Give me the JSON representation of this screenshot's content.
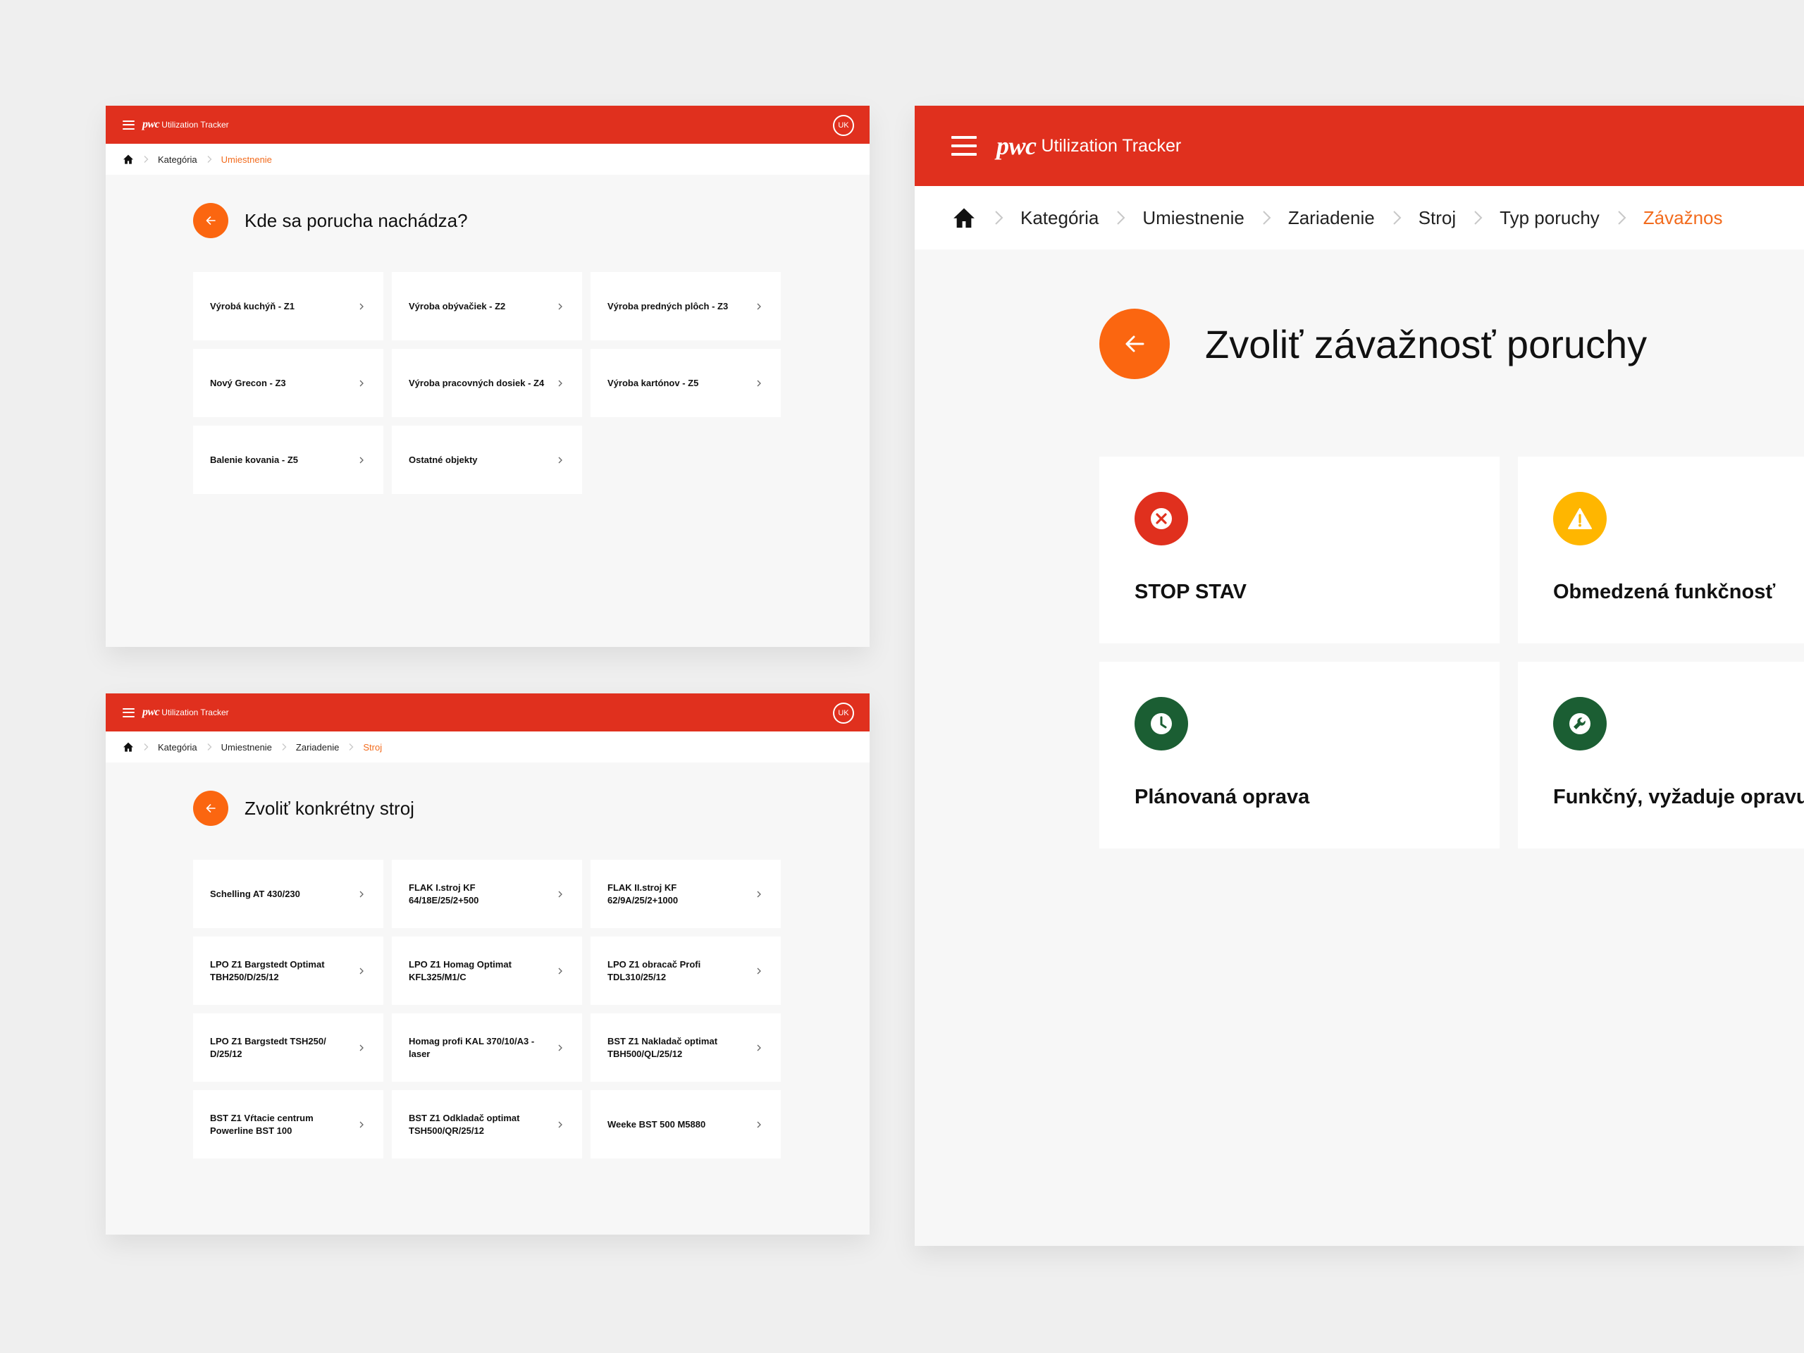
{
  "app": {
    "logo": "pwc",
    "name": "Utilization Tracker",
    "user_initials": "UK",
    "accent_color": "#e0301e",
    "action_color": "#fb6610"
  },
  "screen_location": {
    "breadcrumb": [
      "Kategória",
      "Umiestnenie"
    ],
    "title": "Kde sa porucha nachádza?",
    "options": [
      "Výrobá kuchýň - Z1",
      "Výroba obývačiek - Z2",
      "Výroba predných plôch - Z3",
      "Nový Grecon - Z3",
      "Výroba pracovných dosiek - Z4",
      "Výroba kartónov - Z5",
      "Balenie kovania - Z5",
      "Ostatné objekty"
    ]
  },
  "screen_machine": {
    "breadcrumb": [
      "Kategória",
      "Umiestnenie",
      "Zariadenie",
      "Stroj"
    ],
    "title": "Zvoliť konkrétny stroj",
    "options": [
      "Schelling AT 430/230",
      "FLAK I.stroj KF 64/18E/25/2+500",
      "FLAK II.stroj KF 62/9A/25/2+1000",
      "LPO Z1 Bargstedt Optimat TBH250/D/25/12",
      "LPO Z1 Homag Optimat KFL325/M1/C",
      "LPO Z1 obracač Profi TDL310/25/12",
      "LPO Z1 Bargstedt TSH250/ D/25/12",
      "Homag profi KAL 370/10/A3 - laser",
      "BST Z1 Nakladač optimat TBH500/QL/25/12",
      "BST Z1 Vŕtacie centrum Powerline BST 100",
      "BST Z1 Odkladač optimat TSH500/QR/25/12",
      "Weeke BST 500 M5880"
    ]
  },
  "screen_severity": {
    "breadcrumb": [
      "Kategória",
      "Umiestnenie",
      "Zariadenie",
      "Stroj",
      "Typ poruchy",
      "Závažnos"
    ],
    "title": "Zvoliť závažnosť poruchy",
    "cards": [
      {
        "label": "STOP STAV",
        "icon": "x-circle-icon",
        "color": "#e0301e"
      },
      {
        "label": "Obmedzená funkčnosť",
        "icon": "warning-icon",
        "color": "#ffb600"
      },
      {
        "label": "Plánovaná oprava",
        "icon": "clock-icon",
        "color": "#1b5e33"
      },
      {
        "label": "Funkčný, vyžaduje opravu",
        "icon": "wrench-icon",
        "color": "#1b5e33"
      }
    ]
  }
}
